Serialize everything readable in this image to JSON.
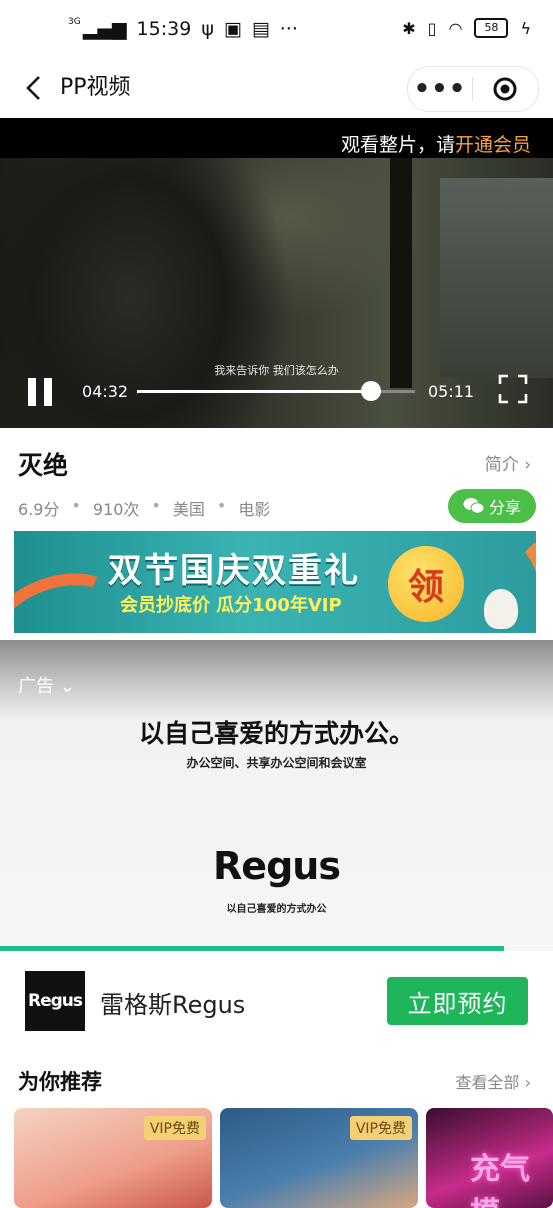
{
  "status_bar": {
    "network": "3G",
    "time": "15:39",
    "battery": "58"
  },
  "header": {
    "title": "PP视频",
    "more_icon": "more-dots-icon",
    "target_icon": "miniprogram-close-icon"
  },
  "player": {
    "upsell_prefix": "观看整片，请",
    "upsell_link": "开通会员",
    "subtitle": "我来告诉你  我们该怎么办",
    "current_time": "04:32",
    "duration": "05:11",
    "progress": 0.84
  },
  "movie": {
    "title": "灭绝",
    "intro_link": "简介",
    "score": "6.9分",
    "views": "910次",
    "region": "美国",
    "type": "电影",
    "share_label": "分享"
  },
  "promo": {
    "main": "双节国庆双重礼",
    "sub": "会员抄底价  瓜分100年VIP",
    "coin": "领"
  },
  "ad": {
    "label": "广告",
    "headline": "以自己喜爱的方式办公。",
    "sub": "办公空间、共享办公空间和会议室",
    "logo": "Regus",
    "logo_tagline": "以自己喜爱的方式办公",
    "advertiser_logo": "Regus",
    "advertiser_name": "雷格斯Regus",
    "cta": "立即预约"
  },
  "recommend": {
    "title": "为你推荐",
    "view_all": "查看全部",
    "cards": [
      {
        "badge": "VIP免费"
      },
      {
        "badge": "VIP免费"
      },
      {
        "badge": "",
        "neon": "充气模"
      }
    ]
  },
  "colors": {
    "accent_orange": "#f7a23e",
    "share_green": "#4bbf47",
    "cta_green": "#1fb55a"
  }
}
